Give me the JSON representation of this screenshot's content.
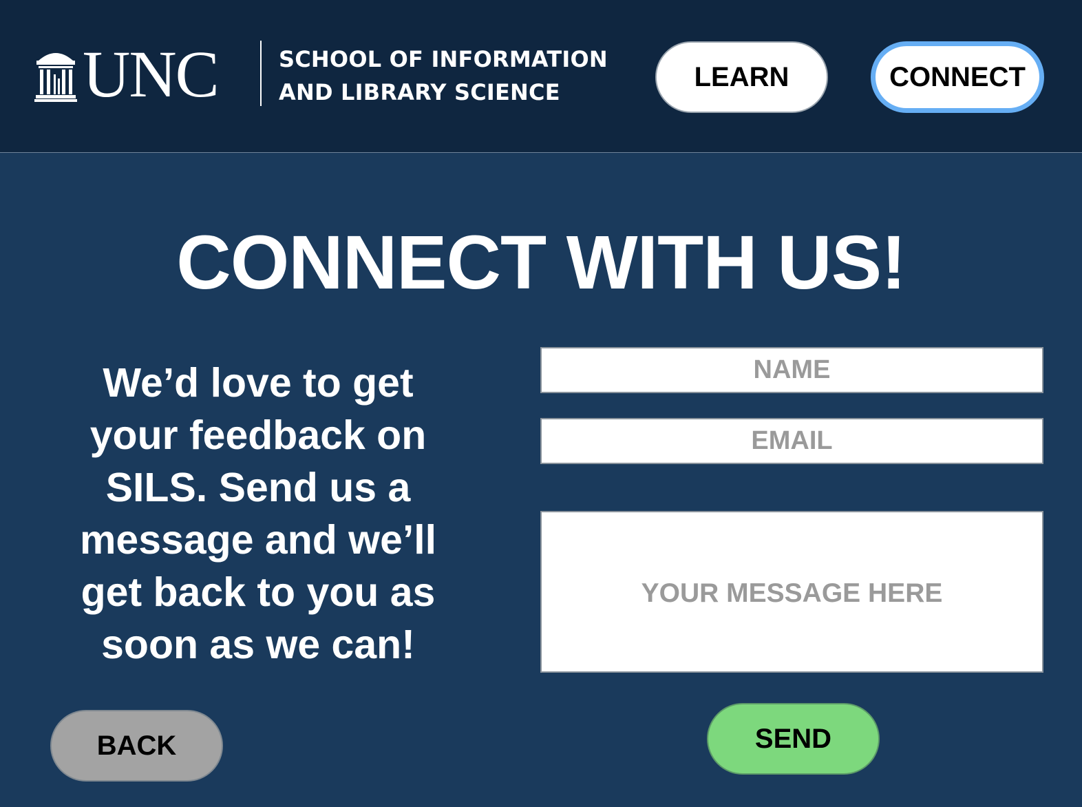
{
  "header": {
    "logo_text": "UNC",
    "school_name_line1": "SCHOOL OF INFORMATION",
    "school_name_line2": "AND LIBRARY SCIENCE",
    "nav": {
      "learn_label": "LEARN",
      "connect_label": "CONNECT",
      "active": "CONNECT"
    }
  },
  "main": {
    "title": "CONNECT WITH US!",
    "intro": "We’d love to get your feedback on SILS. Send us a message and we’ll get back to you as soon as we can!",
    "form": {
      "name_placeholder": "NAME",
      "name_value": "",
      "email_placeholder": "EMAIL",
      "email_value": "",
      "message_placeholder": "YOUR MESSAGE HERE",
      "message_value": "",
      "send_label": "SEND"
    },
    "back_label": "BACK"
  },
  "colors": {
    "header_bg": "#0f2640",
    "page_bg": "#1a3a5c",
    "active_nav_border": "#66aef4",
    "send_button": "#7dd87d",
    "back_button": "#a3a3a3"
  },
  "icons": {
    "logo_mark": "old-well-icon"
  }
}
